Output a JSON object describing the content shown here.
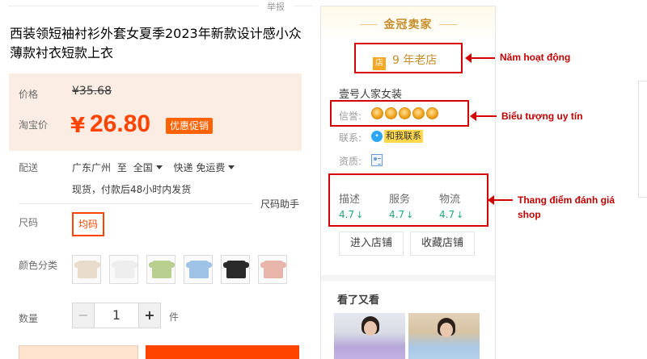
{
  "report_label": "举报",
  "product": {
    "title": "西装领短袖衬衫外套女夏季2023年新款设计感小众薄款衬衣短款上衣",
    "price_label": "价格",
    "old_price": "¥35.68",
    "taobao_price_label": "淘宝价",
    "currency": "¥",
    "price": "26.80",
    "promo_label": "优惠促销"
  },
  "shipping": {
    "label": "配送",
    "from": "广东广州",
    "to_word": "至",
    "region": "全国",
    "method": "快递 免运费",
    "note": "现货，付款后48小时内发货"
  },
  "size": {
    "label": "尺码",
    "helper": "尺码助手",
    "option": "均码"
  },
  "colors": {
    "label": "颜色分类",
    "swatches": [
      "#e9dccd",
      "#eeeeee",
      "#b9cf8f",
      "#9ec3e6",
      "#2a2a2a",
      "#e7b5a9"
    ]
  },
  "quantity": {
    "label": "数量",
    "minus": "−",
    "value": "1",
    "plus": "+",
    "unit": "件"
  },
  "shop": {
    "header": "金冠卖家",
    "age_icon": "店",
    "age": "9 年老店",
    "name": "壹号人家女装",
    "reputation_label": "信誉:",
    "medal_count": 5,
    "contact_label": "联系:",
    "contact_button": "和我联系",
    "qualification_label": "资质:",
    "scores": [
      {
        "name": "描述",
        "value": "4.7",
        "trend": "↓"
      },
      {
        "name": "服务",
        "value": "4.7",
        "trend": "↓"
      },
      {
        "name": "物流",
        "value": "4.7",
        "trend": "↓"
      }
    ],
    "enter_shop": "进入店铺",
    "favorite_shop": "收藏店铺",
    "seen_title": "看了又看"
  },
  "annotations": {
    "years": "Năm hoạt động",
    "reputation": "Biểu tượng uy tín",
    "rating_line1": "Thang điểm đánh giá",
    "rating_line2": "shop"
  },
  "colors_theme": {
    "accent": "#ff4400",
    "gold": "#c68d2b",
    "score_green": "#22a77a",
    "annotation_red": "#d40000"
  }
}
